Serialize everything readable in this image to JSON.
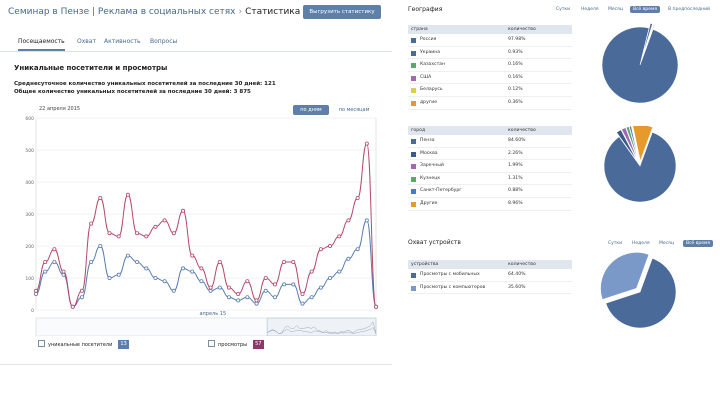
{
  "header": {
    "breadcrumb": [
      "Семинар в Пензе | Реклама в социальных сетях"
    ],
    "current": "Статистика",
    "export_label": "Выгрузить статистику"
  },
  "tabs": [
    {
      "label": "Посещаемость",
      "active": true
    },
    {
      "label": "Охват",
      "active": false
    },
    {
      "label": "Активность",
      "active": false
    },
    {
      "label": "Вопросы",
      "active": false
    }
  ],
  "section": {
    "title": "Уникальные посетители и просмотры",
    "line1": "Среднесуточное количество уникальных посетителей за последние 30 дней: 121",
    "line2": "Общее количество уникальных посетителей за последние 30 дней: 3 875",
    "date": "22 апреля 2015",
    "btn_days": "по дням",
    "btn_months": "по месяцам",
    "month_label": "апрель 15"
  },
  "legend": {
    "visitors_label": "уникальные посетители",
    "visitors_count": "13",
    "views_label": "просмотры",
    "views_count": "57"
  },
  "chart_data": {
    "type": "line",
    "ylim": [
      0,
      600
    ],
    "yticks": [
      0,
      100,
      200,
      300,
      400,
      500,
      600
    ],
    "series": [
      {
        "name": "уникальные посетители",
        "color": "#5a7eb2",
        "values": [
          50,
          120,
          150,
          110,
          10,
          40,
          150,
          200,
          100,
          110,
          170,
          150,
          130,
          100,
          90,
          60,
          130,
          120,
          90,
          60,
          70,
          40,
          30,
          40,
          20,
          60,
          40,
          80,
          80,
          20,
          40,
          70,
          100,
          120,
          160,
          190,
          280,
          10
        ]
      },
      {
        "name": "просмотры",
        "color": "#b54a6b",
        "values": [
          60,
          150,
          190,
          120,
          10,
          60,
          270,
          350,
          240,
          230,
          360,
          240,
          230,
          260,
          280,
          240,
          310,
          170,
          130,
          70,
          150,
          70,
          50,
          90,
          30,
          100,
          80,
          150,
          150,
          50,
          120,
          190,
          200,
          230,
          280,
          350,
          520,
          10
        ]
      }
    ]
  },
  "geo": {
    "title": "География",
    "periods": [
      "Сутки",
      "Неделя",
      "Месяц",
      "Всё время",
      "В предпоследний"
    ],
    "active_period": "Всё время",
    "countries_header": [
      "страна",
      "количество"
    ],
    "countries": [
      {
        "name": "Россия",
        "value": "97.98%",
        "color": "#4a6a9a",
        "pct": 97.98
      },
      {
        "name": "Украина",
        "value": "0.93%",
        "color": "#4a6a9a",
        "pct": 0.93
      },
      {
        "name": "Казахстан",
        "value": "0.16%",
        "color": "#5ba86c",
        "pct": 0.16
      },
      {
        "name": "США",
        "value": "0.16%",
        "color": "#a069b0",
        "pct": 0.16
      },
      {
        "name": "Беларусь",
        "value": "0.12%",
        "color": "#d7d04a",
        "pct": 0.12
      },
      {
        "name": "другие",
        "value": "0.36%",
        "color": "#e59a2b",
        "pct": 0.36
      }
    ],
    "cities_header": [
      "город",
      "количество"
    ],
    "cities": [
      {
        "name": "Пенза",
        "value": "84.60%",
        "color": "#4a6a9a",
        "pct": 84.6
      },
      {
        "name": "Москва",
        "value": "2.26%",
        "color": "#3a5a8a",
        "pct": 2.26
      },
      {
        "name": "Заречный",
        "value": "1.99%",
        "color": "#a069b0",
        "pct": 1.99
      },
      {
        "name": "Кузнецк",
        "value": "1.31%",
        "color": "#5ba86c",
        "pct": 1.31
      },
      {
        "name": "Санкт-Петербург",
        "value": "0.88%",
        "color": "#4a7ac0",
        "pct": 0.88
      },
      {
        "name": "Другие",
        "value": "8.96%",
        "color": "#e59a2b",
        "pct": 8.96
      }
    ]
  },
  "devices": {
    "title": "Охват устройств",
    "periods": [
      "Сутки",
      "Неделя",
      "Месяц",
      "Всё время"
    ],
    "active_period": "Всё время",
    "header": [
      "устройства",
      "количество"
    ],
    "rows": [
      {
        "name": "Просмотры с мобильных",
        "value": "64.40%",
        "color": "#4a6a9a",
        "pct": 64.4
      },
      {
        "name": "Просмотры с компьютеров",
        "value": "35.60%",
        "color": "#7a98c8",
        "pct": 35.6
      }
    ]
  }
}
